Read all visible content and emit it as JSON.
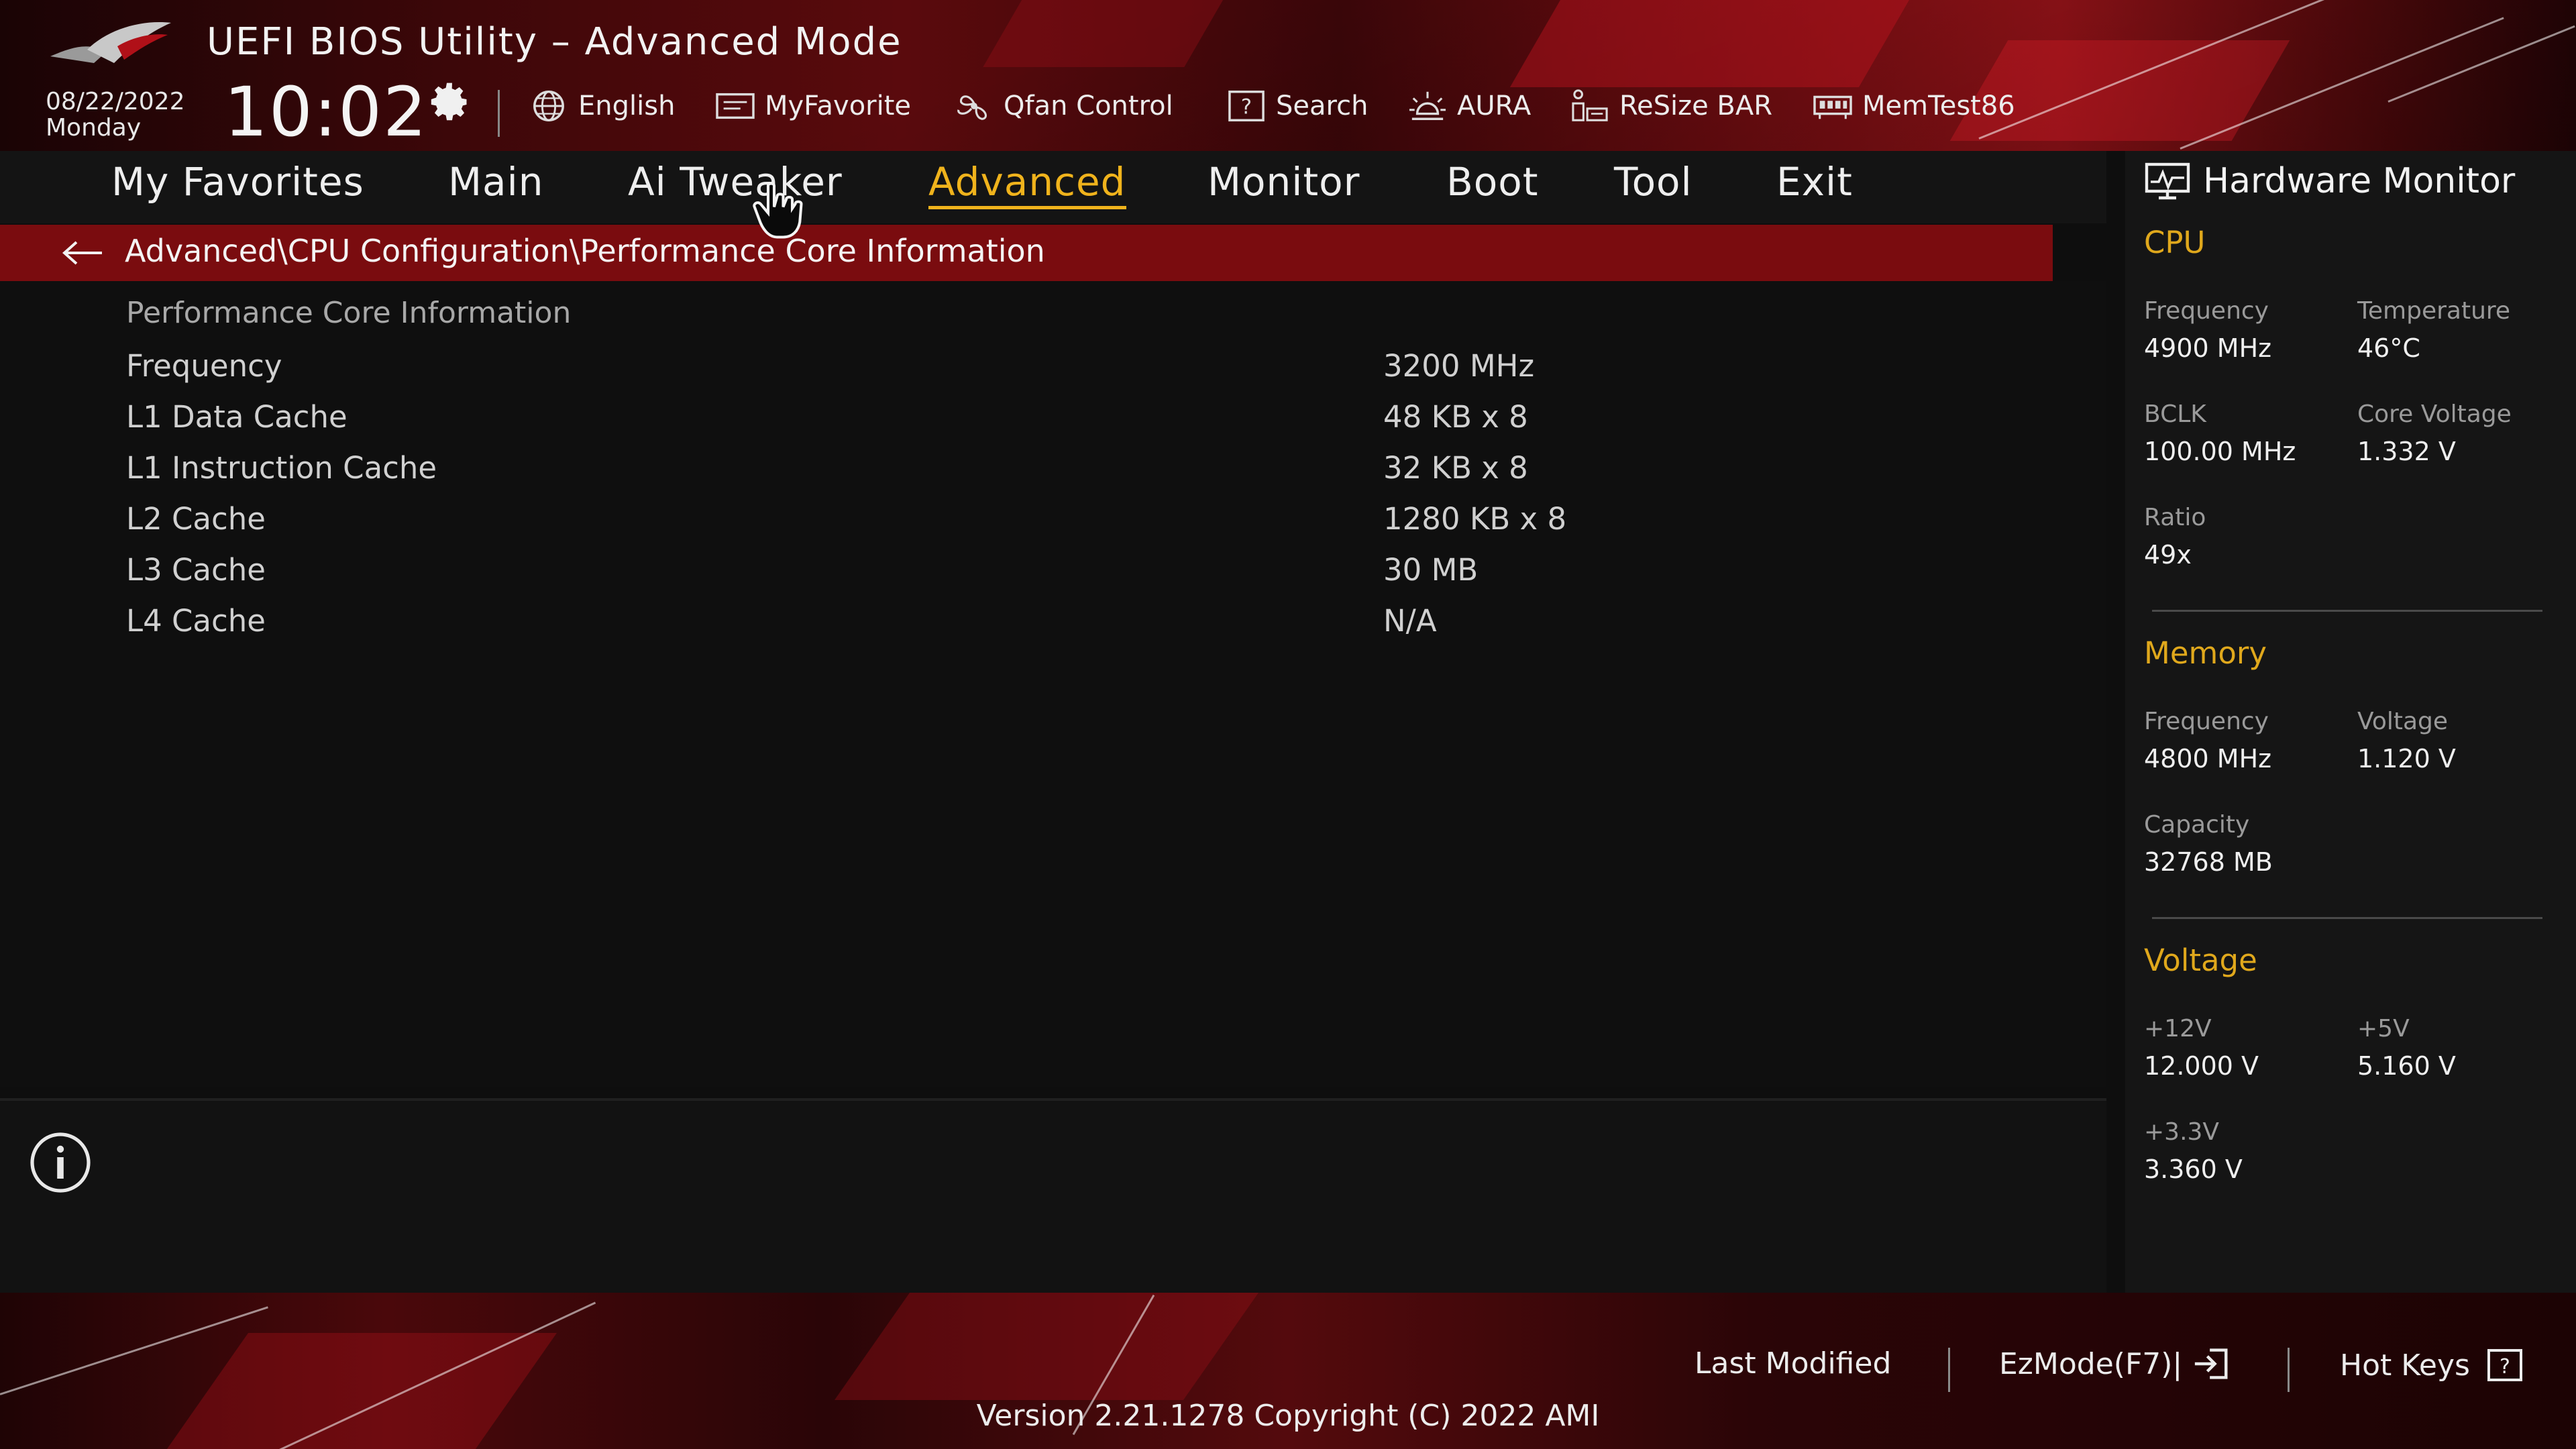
{
  "header": {
    "title": "UEFI BIOS Utility – Advanced Mode",
    "date": "08/22/2022",
    "day": "Monday",
    "time": "10:02",
    "tools": [
      {
        "label": "English",
        "icon": "globe-icon"
      },
      {
        "label": "MyFavorite",
        "icon": "favorite-icon"
      },
      {
        "label": "Qfan Control",
        "icon": "fan-icon"
      },
      {
        "label": "Search",
        "icon": "search-help-icon"
      },
      {
        "label": "AURA",
        "icon": "aura-icon"
      },
      {
        "label": "ReSize BAR",
        "icon": "resize-bar-icon"
      },
      {
        "label": "MemTest86",
        "icon": "memtest-icon"
      }
    ]
  },
  "menu": {
    "items": [
      {
        "label": "My Favorites"
      },
      {
        "label": "Main"
      },
      {
        "label": "Ai Tweaker"
      },
      {
        "label": "Advanced",
        "active": true
      },
      {
        "label": "Monitor"
      },
      {
        "label": "Boot"
      },
      {
        "label": "Tool"
      },
      {
        "label": "Exit"
      }
    ]
  },
  "breadcrumb": "Advanced\\CPU Configuration\\Performance Core Information",
  "main": {
    "section_title": "Performance Core Information",
    "rows": [
      {
        "label": "Frequency",
        "value": "3200 MHz"
      },
      {
        "label": "L1 Data Cache",
        "value": "48 KB x 8"
      },
      {
        "label": "L1 Instruction Cache",
        "value": "32 KB x 8"
      },
      {
        "label": "L2 Cache",
        "value": "1280 KB x 8"
      },
      {
        "label": "L3 Cache",
        "value": "30 MB"
      },
      {
        "label": "L4 Cache",
        "value": "N/A"
      }
    ]
  },
  "hardware_monitor": {
    "title": "Hardware Monitor",
    "cpu": {
      "heading": "CPU",
      "frequency_label": "Frequency",
      "frequency": "4900 MHz",
      "temperature_label": "Temperature",
      "temperature": "46°C",
      "bclk_label": "BCLK",
      "bclk": "100.00 MHz",
      "core_voltage_label": "Core Voltage",
      "core_voltage": "1.332 V",
      "ratio_label": "Ratio",
      "ratio": "49x"
    },
    "memory": {
      "heading": "Memory",
      "frequency_label": "Frequency",
      "frequency": "4800 MHz",
      "voltage_label": "Voltage",
      "voltage": "1.120 V",
      "capacity_label": "Capacity",
      "capacity": "32768 MB"
    },
    "voltage": {
      "heading": "Voltage",
      "v12_label": "+12V",
      "v12": "12.000 V",
      "v5_label": "+5V",
      "v5": "5.160 V",
      "v33_label": "+3.3V",
      "v33": "3.360 V"
    }
  },
  "footer": {
    "last_modified": "Last Modified",
    "ezmode": "EzMode(F7)|",
    "hot_keys": "Hot Keys",
    "version": "Version 2.21.1278 Copyright (C) 2022 AMI"
  },
  "colors": {
    "accent": "#f0b31c",
    "breadcrumb_bg": "#7a0c0f",
    "section_heading": "#e0a81c"
  }
}
